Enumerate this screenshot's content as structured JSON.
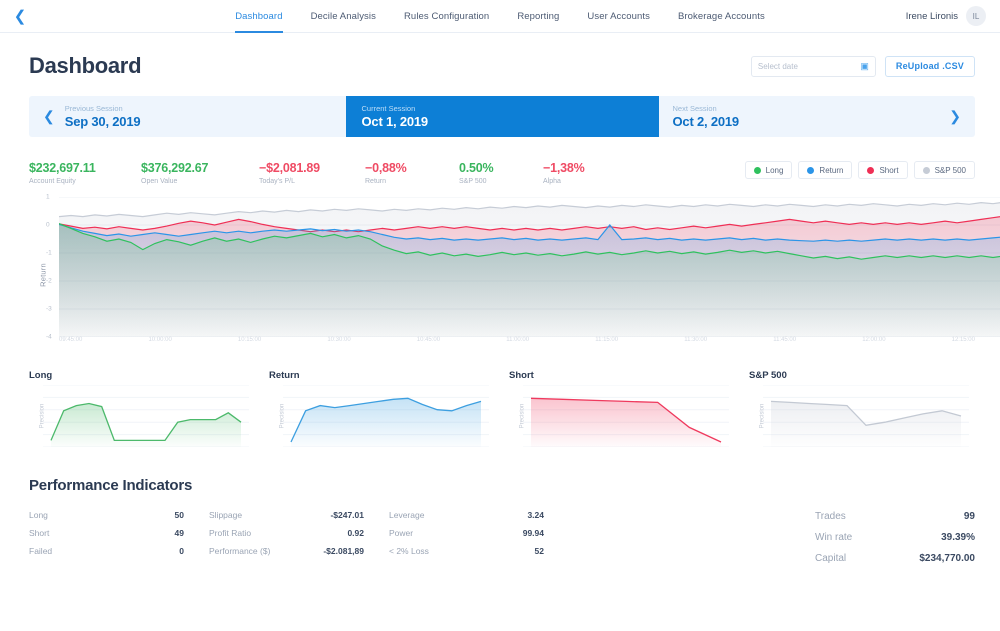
{
  "nav": {
    "back_icon": "chevron-left-icon",
    "items": [
      {
        "label": "Dashboard",
        "active": true
      },
      {
        "label": "Decile Analysis",
        "active": false
      },
      {
        "label": "Rules Configuration",
        "active": false
      },
      {
        "label": "Reporting",
        "active": false
      },
      {
        "label": "User Accounts",
        "active": false
      },
      {
        "label": "Brokerage Accounts",
        "active": false
      }
    ],
    "user_name": "Irene Lironis",
    "user_initials": "IL"
  },
  "header": {
    "title": "Dashboard",
    "date_placeholder": "Select date",
    "date_value": "",
    "calendar_icon": "calendar-icon",
    "upload_button": "ReUpload .CSV"
  },
  "sessions": {
    "prev": {
      "label": "Previous Session",
      "date": "Sep 30, 2019",
      "icon": "chevron-left-icon"
    },
    "current": {
      "label": "Current Session",
      "date": "Oct 1, 2019"
    },
    "next": {
      "label": "Next Session",
      "date": "Oct 2, 2019",
      "icon": "chevron-right-icon"
    }
  },
  "metrics": [
    {
      "value": "$232,697.11",
      "label": "Account Equity",
      "tone": "pos"
    },
    {
      "value": "$376,292.67",
      "label": "Open Value",
      "tone": "pos"
    },
    {
      "value": "−$2,081.89",
      "label": "Today's P/L",
      "tone": "neg"
    },
    {
      "value": "−0,88%",
      "label": "Return",
      "tone": "neg"
    },
    {
      "value": "0.50%",
      "label": "S&P 500",
      "tone": "pos"
    },
    {
      "value": "−1,38%",
      "label": "Alpha",
      "tone": "neg"
    }
  ],
  "legend": [
    {
      "label": "Long",
      "color": "#2fc15e"
    },
    {
      "label": "Return",
      "color": "#2b95e8"
    },
    {
      "label": "Short",
      "color": "#ef2f55"
    },
    {
      "label": "S&P 500",
      "color": "#c6ccd6"
    }
  ],
  "chart_data": [
    {
      "type": "line",
      "title": "",
      "ylabel": "Return",
      "xlabel": "",
      "ylim": [
        -4,
        1
      ],
      "yticks": [
        1,
        0,
        -1,
        -2,
        -3,
        -4
      ],
      "xticks": [
        "09:45:00",
        "10:00:00",
        "10:15:00",
        "10:30:00",
        "10:45:00",
        "11:00:00",
        "11:15:00",
        "11:30:00",
        "11:45:00",
        "12:00:00",
        "12:15:00"
      ],
      "grid": true,
      "legend_position": "top-right",
      "series": [
        {
          "name": "Long",
          "color": "#2fc15e",
          "values": [
            0.05,
            -0.12,
            -0.3,
            -0.42,
            -0.58,
            -0.5,
            -0.62,
            -0.88,
            -0.66,
            -0.52,
            -0.6,
            -0.72,
            -0.58,
            -0.46,
            -0.58,
            -0.5,
            -0.62,
            -0.5,
            -0.4,
            -0.46,
            -0.38,
            -0.3,
            -0.42,
            -0.34,
            -0.46,
            -0.38,
            -0.5,
            -0.75,
            -0.9,
            -1.02,
            -0.96,
            -1.08,
            -1.0,
            -1.1,
            -1.04,
            -1.12,
            -1.06,
            -0.98,
            -1.06,
            -1.0,
            -1.08,
            -1.02,
            -1.1,
            -1.04,
            -0.96,
            -1.04,
            -0.98,
            -1.06,
            -1.0,
            -0.92,
            -1.0,
            -0.94,
            -1.02,
            -0.96,
            -1.04,
            -0.98,
            -0.9,
            -0.98,
            -0.92,
            -1.0,
            -0.94,
            -1.02,
            -1.1,
            -1.18,
            -1.12,
            -1.2,
            -1.14,
            -1.22,
            -1.16,
            -1.1,
            -1.16,
            -1.1,
            -1.16,
            -1.1,
            -1.16,
            -1.1,
            -1.16,
            -1.1,
            -1.16,
            -1.1
          ]
        },
        {
          "name": "Return",
          "color": "#2b95e8",
          "values": [
            0.02,
            -0.1,
            -0.22,
            -0.3,
            -0.38,
            -0.32,
            -0.4,
            -0.34,
            -0.28,
            -0.34,
            -0.4,
            -0.34,
            -0.28,
            -0.22,
            -0.28,
            -0.22,
            -0.28,
            -0.22,
            -0.18,
            -0.22,
            -0.18,
            -0.14,
            -0.2,
            -0.16,
            -0.22,
            -0.18,
            -0.24,
            -0.34,
            -0.44,
            -0.5,
            -0.46,
            -0.52,
            -0.48,
            -0.54,
            -0.5,
            -0.54,
            -0.5,
            -0.46,
            -0.52,
            -0.48,
            -0.54,
            -0.5,
            -0.54,
            -0.5,
            -0.46,
            -0.52,
            0.0,
            -0.52,
            -0.5,
            -0.46,
            -0.52,
            -0.48,
            -0.54,
            -0.5,
            -0.54,
            -0.5,
            -0.46,
            -0.52,
            -0.48,
            -0.54,
            -0.5,
            -0.54,
            -0.56,
            -0.58,
            -0.54,
            -0.58,
            -0.54,
            -0.58,
            -0.54,
            -0.5,
            -0.54,
            -0.5,
            -0.54,
            -0.5,
            -0.54,
            -0.5,
            -0.54,
            -0.5,
            -0.46,
            -0.42
          ]
        },
        {
          "name": "Short",
          "color": "#ef2f55",
          "values": [
            0.04,
            -0.04,
            -0.12,
            -0.08,
            -0.14,
            -0.06,
            -0.12,
            -0.18,
            -0.12,
            -0.04,
            0.06,
            0.14,
            0.08,
            0.0,
            0.1,
            0.2,
            0.12,
            0.02,
            -0.06,
            -0.12,
            -0.18,
            -0.24,
            -0.18,
            -0.24,
            -0.18,
            -0.24,
            -0.18,
            -0.12,
            -0.18,
            -0.12,
            -0.06,
            -0.12,
            -0.06,
            -0.12,
            -0.06,
            -0.12,
            -0.18,
            -0.12,
            -0.18,
            -0.12,
            -0.18,
            -0.12,
            -0.18,
            -0.12,
            -0.06,
            -0.12,
            -0.06,
            -0.12,
            -0.06,
            -0.16,
            -0.1,
            -0.16,
            -0.1,
            -0.04,
            -0.1,
            -0.04,
            0.02,
            -0.04,
            0.02,
            0.08,
            0.14,
            0.2,
            0.14,
            0.08,
            0.14,
            0.08,
            0.02,
            0.08,
            0.02,
            0.08,
            0.02,
            0.08,
            0.02,
            0.08,
            0.14,
            0.08,
            0.14,
            0.2,
            0.26,
            0.32
          ]
        },
        {
          "name": "S&P 500",
          "color": "#c6ccd6",
          "values": [
            0.3,
            0.34,
            0.3,
            0.36,
            0.32,
            0.38,
            0.34,
            0.3,
            0.36,
            0.42,
            0.38,
            0.44,
            0.4,
            0.36,
            0.42,
            0.48,
            0.44,
            0.5,
            0.46,
            0.52,
            0.48,
            0.54,
            0.5,
            0.56,
            0.52,
            0.58,
            0.54,
            0.5,
            0.56,
            0.52,
            0.58,
            0.54,
            0.6,
            0.56,
            0.62,
            0.58,
            0.64,
            0.6,
            0.66,
            0.62,
            0.68,
            0.64,
            0.7,
            0.66,
            0.62,
            0.68,
            0.64,
            0.7,
            0.66,
            0.72,
            0.68,
            0.64,
            0.7,
            0.66,
            0.72,
            0.68,
            0.74,
            0.7,
            0.66,
            0.72,
            0.68,
            0.74,
            0.7,
            0.66,
            0.72,
            0.68,
            0.74,
            0.7,
            0.76,
            0.72,
            0.68,
            0.74,
            0.7,
            0.76,
            0.72,
            0.78,
            0.74,
            0.8,
            0.76,
            0.82
          ]
        }
      ]
    },
    {
      "type": "area",
      "title": "Long",
      "ylabel": "Precision",
      "color": "#4cb96b",
      "values": [
        0.05,
        0.62,
        0.72,
        0.76,
        0.7,
        0.05,
        0.05,
        0.05,
        0.05,
        0.05,
        0.4,
        0.45,
        0.45,
        0.45,
        0.58,
        0.4
      ],
      "grid": true
    },
    {
      "type": "area",
      "title": "Return",
      "ylabel": "Precision",
      "color": "#3d9fe0",
      "values": [
        0.02,
        0.62,
        0.72,
        0.68,
        0.72,
        0.76,
        0.8,
        0.84,
        0.86,
        0.74,
        0.64,
        0.62,
        0.72,
        0.8
      ],
      "grid": true
    },
    {
      "type": "area",
      "title": "Short",
      "ylabel": "Precision",
      "color": "#ef3a5e",
      "values": [
        0.86,
        0.84,
        0.82,
        0.8,
        0.78,
        0.3,
        0.02
      ],
      "grid": true
    },
    {
      "type": "area",
      "title": "S&P 500",
      "ylabel": "Precision",
      "color": "#c3c9d3",
      "values": [
        0.8,
        0.78,
        0.76,
        0.74,
        0.72,
        0.34,
        0.4,
        0.48,
        0.56,
        0.62,
        0.52
      ],
      "grid": true
    }
  ],
  "performance": {
    "title": "Performance Indicators",
    "columns": [
      {
        "rows": [
          {
            "key": "Long",
            "value": "50"
          },
          {
            "key": "Short",
            "value": "49"
          },
          {
            "key": "Failed",
            "value": "0"
          }
        ]
      },
      {
        "rows": [
          {
            "key": "Slippage",
            "value": "-$247.01"
          },
          {
            "key": "Profit Ratio",
            "value": "0.92"
          },
          {
            "key": "Performance ($)",
            "value": "-$2.081,89"
          }
        ]
      },
      {
        "rows": [
          {
            "key": "Leverage",
            "value": "3.24"
          },
          {
            "key": "Power",
            "value": "99.94"
          },
          {
            "key": "< 2% Loss",
            "value": "52"
          }
        ]
      }
    ],
    "summary": {
      "rows": [
        {
          "key": "Trades",
          "value": "99"
        },
        {
          "key": "Win rate",
          "value": "39.39%"
        },
        {
          "key": "Capital",
          "value": "$234,770.00"
        }
      ]
    }
  }
}
